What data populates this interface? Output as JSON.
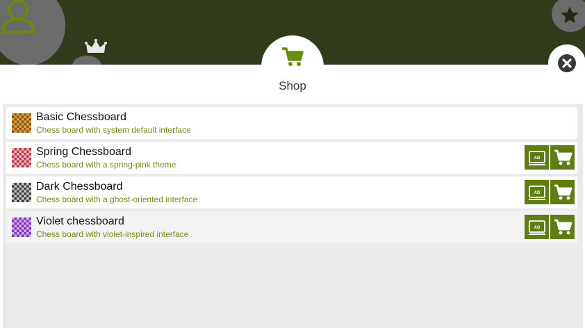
{
  "colors": {
    "header_bg": "#2f3b1b",
    "accent": "#5f7d14",
    "subtitle": "#6f8f1a",
    "icon_green": "#6a8a10",
    "list_bg": "#eaeaea"
  },
  "header": {
    "icons": [
      "avatar-icon",
      "crown-icon",
      "star-icon"
    ]
  },
  "dialog": {
    "title": "Shop",
    "tab_icon": "cart-icon",
    "close_icon": "close-icon"
  },
  "items": [
    {
      "title": "Basic Chessboard",
      "subtitle": "Chess board with system default interface",
      "thumb_colors": [
        "#8b5a1e",
        "#d8a040"
      ],
      "actions": []
    },
    {
      "title": "Spring Chessboard",
      "subtitle": "Chess board with a spring-pink theme",
      "thumb_colors": [
        "#b73a4a",
        "#f2b4c0"
      ],
      "actions": [
        {
          "icon": "ad-icon",
          "label": "AD"
        },
        {
          "icon": "cart-icon"
        }
      ]
    },
    {
      "title": "Dark Chessboard",
      "subtitle": "Chess board with a ghost-oriented interface",
      "thumb_colors": [
        "#3a3a3a",
        "#c8c8c8"
      ],
      "actions": [
        {
          "icon": "ad-icon",
          "label": "AD"
        },
        {
          "icon": "cart-icon"
        }
      ]
    },
    {
      "title": "Violet chessboard",
      "subtitle": "Chess board with violet-inspired interface",
      "thumb_colors": [
        "#7a3ab0",
        "#d8a8f0"
      ],
      "actions": [
        {
          "icon": "ad-icon",
          "label": "AD"
        },
        {
          "icon": "cart-icon"
        }
      ]
    }
  ]
}
